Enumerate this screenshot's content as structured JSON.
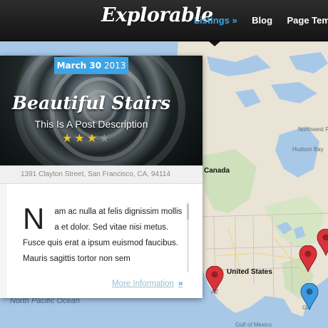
{
  "header": {
    "logo": "Explorable",
    "nav": [
      {
        "label": "Listings »",
        "active": true
      },
      {
        "label": "Blog",
        "active": false
      },
      {
        "label": "Page Templates",
        "active": false
      }
    ]
  },
  "card": {
    "date_day": "March 30",
    "date_year": "2013",
    "title": "Beautiful Stairs",
    "subtitle": "This Is A Post Description",
    "rating": 3,
    "rating_max": 4,
    "address": "1391 Clayton Street, San Francisco, CA, 94114",
    "excerpt_dropcap": "N",
    "excerpt": "am ac nulla at felis dignissim mollis a et dolor. Sed vitae nisi metus. Fusce quis erat a ipsum euismod faucibus. Mauris sagittis tortor non sem",
    "more_label": "More Information",
    "more_arrow": "»"
  },
  "map": {
    "labels": {
      "canada": "Canada",
      "united_states": "United States",
      "northwest_passages": "Northwest Passages",
      "hudson_bay": "Hudson Bay",
      "north_pacific_ocean": "North Pacific Ocean",
      "gulf_of_mexico": "Gulf of Mexico",
      "az": "AZ",
      "ga": "GA"
    },
    "colors": {
      "water": "#a8c8e8",
      "land": "#e9e4d6",
      "forest": "#cfe0bd",
      "pin_red": "#d8333a",
      "pin_blue": "#3d9be0"
    }
  }
}
